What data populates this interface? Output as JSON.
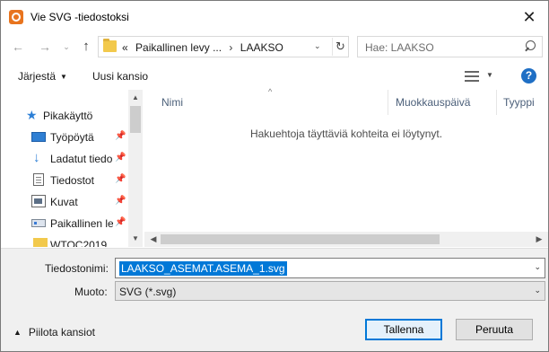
{
  "window": {
    "title": "Vie SVG -tiedostoksi",
    "close_glyph": "✕"
  },
  "nav": {
    "back_glyph": "←",
    "forward_glyph": "→",
    "recent_glyph": "⌄",
    "up_glyph": "↑",
    "address": {
      "overflow": "«",
      "segments": [
        "Paikallinen levy ...",
        "LAAKSO"
      ],
      "separator": "›",
      "dropdown_glyph": "⌄",
      "refresh_glyph": "↻"
    },
    "search": {
      "placeholder": "Hae: LAAKSO"
    }
  },
  "toolbar": {
    "organize_label": "Järjestä",
    "organize_caret": "▼",
    "new_folder_label": "Uusi kansio",
    "view_caret": "▼",
    "help_label": "?"
  },
  "navpane": {
    "items": [
      {
        "label": "Pikakäyttö",
        "icon": "star-icon",
        "glyph": "★"
      },
      {
        "label": "Työpöytä",
        "icon": "desktop-icon",
        "pinned": true
      },
      {
        "label": "Ladatut tiedo",
        "icon": "download-icon",
        "glyph": "↓",
        "pinned": true
      },
      {
        "label": "Tiedostot",
        "icon": "documents-icon",
        "pinned": true
      },
      {
        "label": "Kuvat",
        "icon": "pictures-icon",
        "pinned": true
      },
      {
        "label": "Paikallinen le",
        "icon": "local-disk-icon",
        "pinned": true
      },
      {
        "label": "WTOC2019",
        "icon": "folder-icon"
      }
    ],
    "pin_glyph": "📌",
    "scroll_up": "▲",
    "scroll_down": "▼"
  },
  "filelist": {
    "columns": [
      "Nimi",
      "Muokkauspäivä",
      "Tyyppi"
    ],
    "sort_glyph": "^",
    "empty_message": "Hakuehtoja täyttäviä kohteita ei löytynyt.",
    "scroll_left": "◀",
    "scroll_right": "▶"
  },
  "form": {
    "filename_label": "Tiedostonimi:",
    "filename_value": "LAAKSO_ASEMAT.ASEMA_1.svg",
    "type_label": "Muoto:",
    "type_value": "SVG (*.svg)",
    "dropdown_glyph": "⌄"
  },
  "footer": {
    "hide_folders_label": "Piilota kansiot",
    "hide_folders_glyph": "▲",
    "save_label": "Tallenna",
    "cancel_label": "Peruuta"
  },
  "colors": {
    "accent": "#0078d7",
    "app_icon": "#e8741e",
    "folder": "#f2c94c",
    "help": "#1f6fc5"
  }
}
